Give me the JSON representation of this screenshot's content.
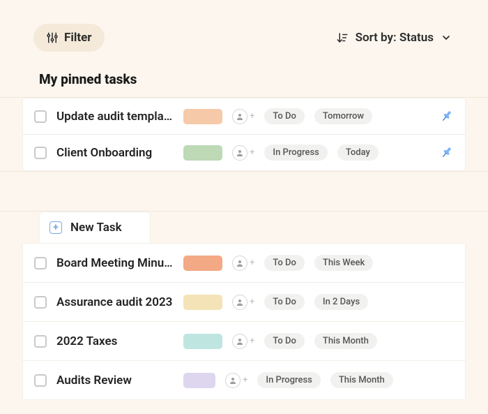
{
  "topbar": {
    "filter_label": "Filter",
    "sort_label": "Sort by: Status"
  },
  "pinned": {
    "heading": "My pinned tasks",
    "tasks": [
      {
        "title": "Update audit templates",
        "color": "#f6c9a8",
        "color_width": 56,
        "status": "To Do",
        "due": "Tomorrow",
        "pinned": true
      },
      {
        "title": "Client Onboarding",
        "color": "#bdd9b6",
        "color_width": 56,
        "status": "In Progress",
        "due": "Today",
        "pinned": true
      }
    ]
  },
  "newtask": {
    "label": "New Task"
  },
  "list": {
    "tasks": [
      {
        "title": "Board Meeting Minutes",
        "color": "#f3a985",
        "color_width": 56,
        "status": "To Do",
        "due": "This Week"
      },
      {
        "title": "Assurance audit 2023",
        "color": "#f4e3b6",
        "color_width": 56,
        "status": "To Do",
        "due": "In 2 Days"
      },
      {
        "title": "2022 Taxes",
        "color": "#bfe5e1",
        "color_width": 56,
        "status": "To Do",
        "due": "This Month"
      },
      {
        "title": "Audits Review",
        "color": "#ded6ef",
        "color_width": 46,
        "status": "In Progress",
        "due": "This Month"
      }
    ]
  }
}
